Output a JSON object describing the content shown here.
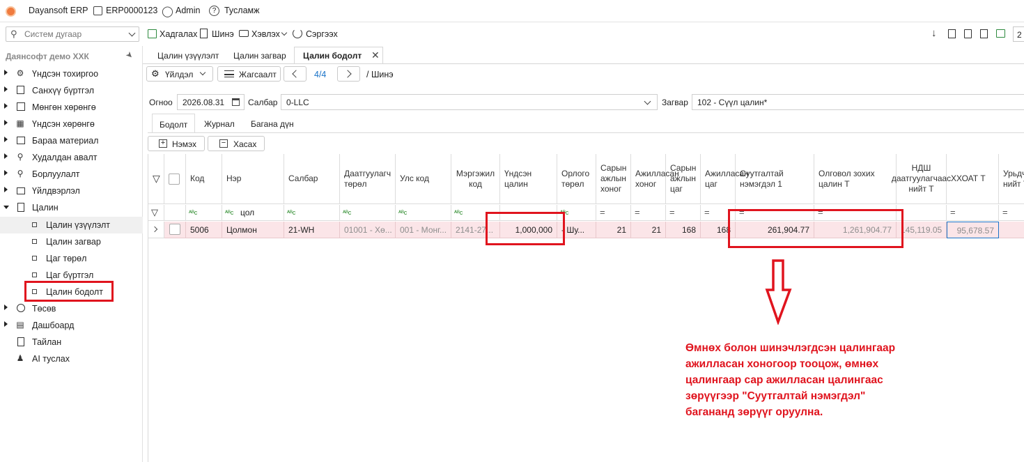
{
  "topbar": {
    "app_name": "Dayansoft ERP",
    "code": "ERP0000123",
    "user": "Admin",
    "help": "Тусламж"
  },
  "search": {
    "placeholder": "Систем дугаар"
  },
  "toolbar": {
    "save": "Хадгалах",
    "new": "Шинэ",
    "print": "Хэвлэх",
    "refresh": "Сэргээх",
    "right_value": "2"
  },
  "sidebar": {
    "company": "Даянсофт демо ХХК",
    "items": [
      {
        "label": "Үндсэн тохиргоо",
        "icon": "gear-icon"
      },
      {
        "label": "Санхүү бүртгэл",
        "icon": "ledger-icon"
      },
      {
        "label": "Мөнгөн хөрөнгө",
        "icon": "cash-icon"
      },
      {
        "label": "Үндсэн хөрөнгө",
        "icon": "building-icon"
      },
      {
        "label": "Бараа материал",
        "icon": "box-icon"
      },
      {
        "label": "Худалдан авалт",
        "icon": "cart-icon"
      },
      {
        "label": "Борлуулалт",
        "icon": "sale-cart-icon"
      },
      {
        "label": "Үйлдвэрлэл",
        "icon": "factory-icon"
      },
      {
        "label": "Цалин",
        "icon": "calculator-icon"
      }
    ],
    "payroll_children": [
      {
        "label": "Цалин үзүүлэлт"
      },
      {
        "label": "Цалин загвар"
      },
      {
        "label": "Цаг төрөл"
      },
      {
        "label": "Цаг бүртгэл"
      },
      {
        "label": "Цалин бодолт"
      }
    ],
    "after_items": [
      {
        "label": "Төсөв",
        "icon": "pie-chart-icon"
      },
      {
        "label": "Дашбоард",
        "icon": "dashboard-icon"
      },
      {
        "label": "Тайлан",
        "icon": "report-icon"
      },
      {
        "label": "AI туслах",
        "icon": "ai-assistant-icon"
      }
    ]
  },
  "tabs": [
    "Цалин үзүүлэлт",
    "Цалин загвар",
    "Цалин бодолт"
  ],
  "actions": {
    "operation": "Үйлдэл",
    "list": "Жагсаалт",
    "pager": "4/4",
    "breadcrumb": "/ Шинэ"
  },
  "filters": {
    "date_label": "Огноо",
    "date_value": "2026.08.31",
    "branch_label": "Салбар",
    "branch_value": "0-LLC",
    "template_label": "Загвар",
    "template_value": "102 - Сүүл цалин*"
  },
  "subtabs": [
    "Бодолт",
    "Журнал",
    "Багана дүн"
  ],
  "grid_buttons": {
    "add": "Нэмэх",
    "delete": "Хасах"
  },
  "columns": [
    "Код",
    "Нэр",
    "Салбар",
    "Даатгуулагч төрөл",
    "Улс код",
    "Мэргэжил код",
    "Үндсэн цалин",
    "Орлого төрөл",
    "Сарын ажлын хоног",
    "Ажилласан хоног",
    "Сарын ажлын цаг",
    "Ажилласан цаг",
    "Суутгалтай нэмэгдэл 1",
    "Олговол зохих цалин Т",
    "НДШ даатгуулагчаас нийт Т",
    "ХХОАТ Т",
    "Урьдчилгаа нийт Т"
  ],
  "filter_row": {
    "name_filter": "цол"
  },
  "row": {
    "code": "5006",
    "name": "Цолмон",
    "branch": "21-WH",
    "insured_type": "01001 - Хө...",
    "country_code": "001 - Монг...",
    "profession_code": "2141-27...",
    "base_salary": "1,000,000",
    "income_type": "- Шу...",
    "month_work_days": "21",
    "worked_days": "21",
    "month_work_hours": "168",
    "worked_hours": "168",
    "withheld_bonus": "261,904.77",
    "payable_salary": "1,261,904.77",
    "social_insurance": "145,119.05",
    "income_tax": "95,678.57"
  },
  "note": "Өмнөх болон шинэчлэгдсэн цалингаар ажилласан хоногоор тооцож, өмнөх цалингаар сар ажилласан цалингаас зөрүүгээр \"Суутгалтай нэмэгдэл\" багананд зөрүүг оруулна.",
  "colors": {
    "annotation_red": "#e0141e",
    "row_highlight": "#fbe5e8",
    "accent_blue": "#1a73c8"
  }
}
